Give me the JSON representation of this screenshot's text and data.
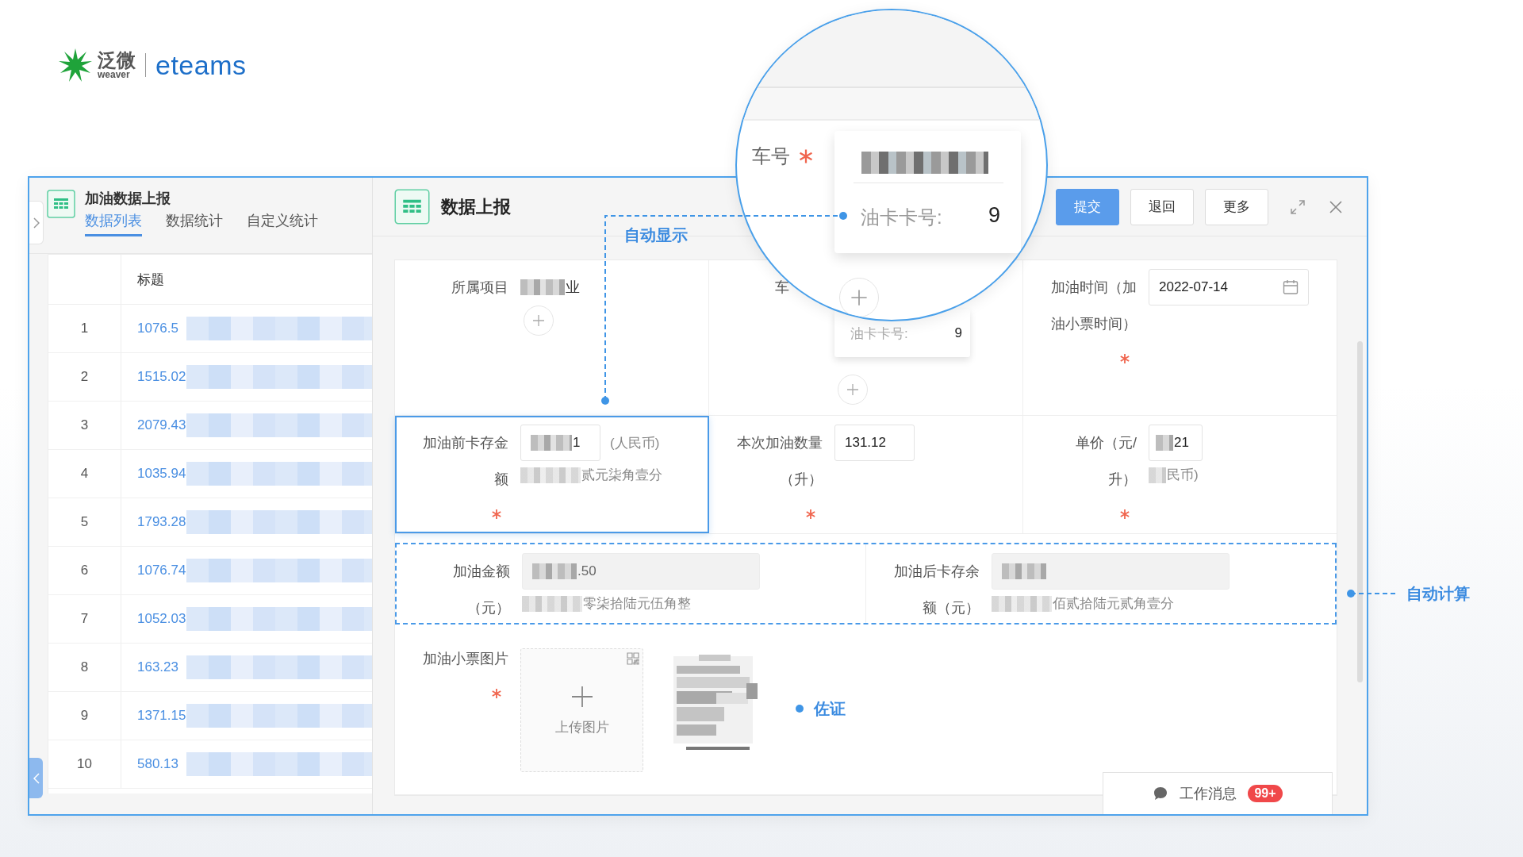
{
  "logo": {
    "cn": "泛微",
    "en": "weaver",
    "product": "eteams"
  },
  "list_panel": {
    "title": "加油数据上报",
    "tabs": [
      {
        "label": "数据列表",
        "selected": true
      },
      {
        "label": "数据统计",
        "selected": false
      },
      {
        "label": "自定义统计",
        "selected": false
      }
    ],
    "table": {
      "columns": [
        "标题"
      ],
      "rows": [
        {
          "index": "1",
          "title": "1076.5"
        },
        {
          "index": "2",
          "title": "1515.02"
        },
        {
          "index": "3",
          "title": "2079.43"
        },
        {
          "index": "4",
          "title": "1035.94"
        },
        {
          "index": "5",
          "title": "1793.28"
        },
        {
          "index": "6",
          "title": "1076.74"
        },
        {
          "index": "7",
          "title": "1052.03"
        },
        {
          "index": "8",
          "title": "163.23"
        },
        {
          "index": "9",
          "title": "1371.15"
        },
        {
          "index": "10",
          "title": "580.13"
        }
      ]
    }
  },
  "form_panel": {
    "title": "数据上报",
    "buttons": [
      {
        "label": "提交",
        "kind": "primary"
      },
      {
        "label": "退回",
        "kind": "default"
      },
      {
        "label": "更多",
        "kind": "default"
      }
    ],
    "rows": [
      {
        "outlined": false,
        "cells": [
          {
            "kind": "text",
            "label": "所属项目",
            "value": "业",
            "value_masked": true,
            "addable": true,
            "required": false
          },
          {
            "kind": "vehicle",
            "label": "车",
            "card_label": "油卡卡号:",
            "card_value": "9",
            "addable": true
          },
          {
            "kind": "date",
            "label": "加油时间（加油小票时间）",
            "value": "2022-07-14",
            "required": true
          }
        ]
      },
      {
        "outlined": false,
        "cells": [
          {
            "kind": "input",
            "label": "加油前卡存金额",
            "value": "1",
            "value_masked": true,
            "unit": "(人民币)",
            "words": "贰元柒角壹分",
            "words_masked": true,
            "required": true,
            "highlighted": true
          },
          {
            "kind": "input",
            "label": "本次加油数量（升）",
            "value": "131.12",
            "value_masked": false,
            "required": true,
            "highlighted": false
          },
          {
            "kind": "input",
            "label": "单价（元/升）",
            "value": "21",
            "value_masked": true,
            "words": "民币)",
            "words_masked": true,
            "required": true,
            "highlighted": false
          }
        ]
      },
      {
        "outlined": true,
        "cells": [
          {
            "kind": "readonly",
            "label": "加油金额（元）",
            "value": ".50",
            "value_masked": true,
            "words": "零柒拾陆元伍角整",
            "words_masked": true,
            "required": false
          },
          {
            "kind": "readonly",
            "label": "加油后卡存余额（元）",
            "value_masked": true,
            "words": "佰贰拾陆元贰角壹分",
            "words_masked": true,
            "required": false
          }
        ]
      },
      {
        "outlined": false,
        "cells": [
          {
            "kind": "upload",
            "label": "加油小票图片",
            "upload_label": "上传图片",
            "required": true
          }
        ]
      }
    ]
  },
  "magnifier": {
    "label": "车号",
    "required": true,
    "card_label": "油卡卡号:",
    "card_value": "9"
  },
  "annotations": [
    {
      "text": "自动显示"
    },
    {
      "text": "自动计算"
    },
    {
      "text": "佐证"
    }
  ],
  "work_message": {
    "label": "工作消息",
    "badge": "99+"
  }
}
